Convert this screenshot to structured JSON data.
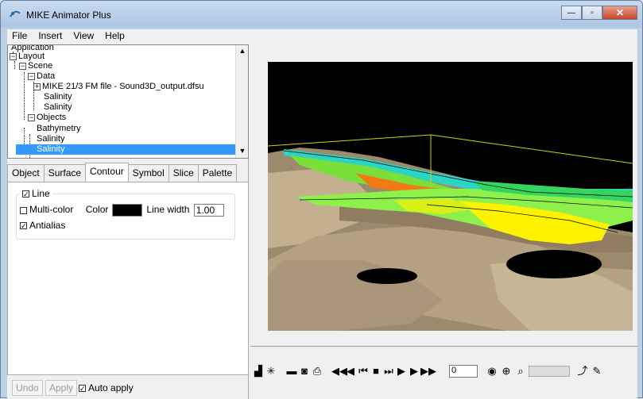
{
  "window": {
    "title": "MIKE Animator Plus"
  },
  "menu": [
    "File",
    "Insert",
    "View",
    "Help"
  ],
  "tree": {
    "items": [
      {
        "label": "Application",
        "selected": false
      },
      {
        "label": "Layout",
        "selected": false
      },
      {
        "label": "Scene",
        "selected": false
      },
      {
        "label": "Data",
        "selected": false
      },
      {
        "label": "MIKE 21/3 FM file - Sound3D_output.dfsu",
        "selected": false
      },
      {
        "label": "Salinity",
        "selected": false
      },
      {
        "label": "Salinity",
        "selected": false
      },
      {
        "label": "Objects",
        "selected": false
      },
      {
        "label": "Bathymetry",
        "selected": false
      },
      {
        "label": "Salinity",
        "selected": false
      },
      {
        "label": "Salinity",
        "selected": true
      }
    ]
  },
  "tabs": [
    "Object",
    "Surface",
    "Contour",
    "Symbol",
    "Slice",
    "Palette"
  ],
  "active_tab": "Contour",
  "contour": {
    "group_label": "Line",
    "line_checked": true,
    "multicolor_label": "Multi-color",
    "multicolor_checked": false,
    "color_label": "Color",
    "color_value": "#000000",
    "line_width_label": "Line width",
    "line_width_value": "1.00",
    "antialias_label": "Antialias",
    "antialias_checked": true
  },
  "bottom": {
    "undo": "Undo",
    "apply": "Apply",
    "auto_apply": "Auto apply",
    "auto_apply_checked": true
  },
  "toolbar": {
    "frame_value": "0"
  },
  "colors": {
    "selection": "#3399ff",
    "viewport_bg": "#000000",
    "terrain": "#b9a68a",
    "box_edges": "#d4d400"
  }
}
